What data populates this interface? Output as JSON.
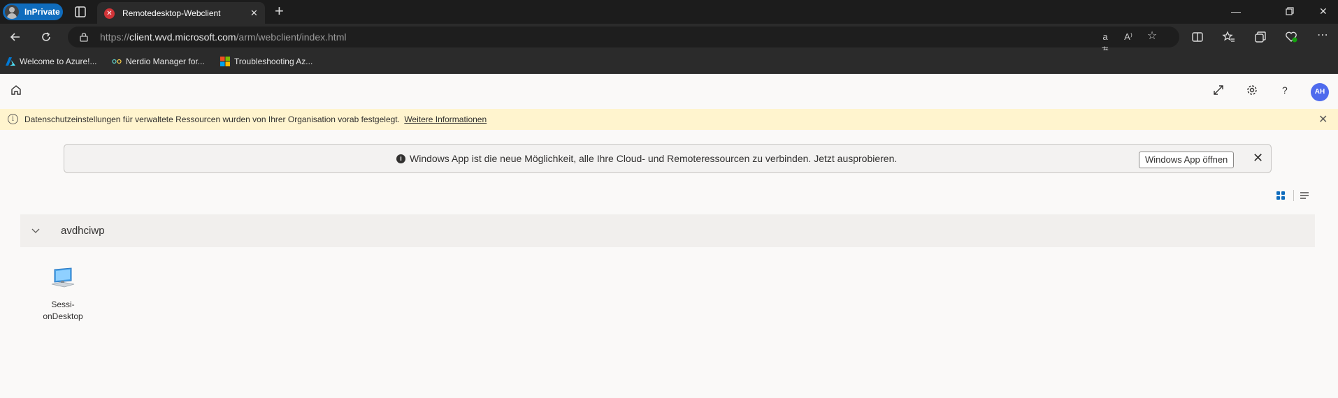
{
  "browser": {
    "profile_label": "InPrivate",
    "tab_title": "Remotedesktop-Webclient",
    "url_prefix": "https://",
    "url_host": "client.wvd.microsoft.com",
    "url_path": "/arm/webclient/index.html",
    "read_aloud_label": "aあ",
    "bookmarks": [
      {
        "label": "Welcome to Azure!...",
        "icon": "azure-icon"
      },
      {
        "label": "Nerdio Manager for...",
        "icon": "nerdio-icon"
      },
      {
        "label": "Troubleshooting Az...",
        "icon": "microsoft-logo-icon"
      }
    ]
  },
  "app": {
    "user_initials": "AH",
    "privacy_notice": {
      "text": "Datenschutzeinstellungen für verwaltete Ressourcen wurden von Ihrer Organisation vorab festgelegt.",
      "link": "Weitere Informationen"
    },
    "promo": {
      "text": "Windows App ist die neue Möglichkeit, alle Ihre Cloud- und Remoteressourcen zu verbinden. Jetzt ausprobieren.",
      "button": "Windows App öffnen"
    },
    "group": {
      "name": "avdhciwp",
      "resources": [
        {
          "line1": "Sessi-",
          "line2": "onDesktop",
          "icon": "desktop-pc-icon"
        }
      ]
    }
  },
  "colors": {
    "accent": "#0f6cbd",
    "avatar": "#4f6bed",
    "privacy_bg": "#fff4ce",
    "page_bg": "#faf9f8"
  }
}
